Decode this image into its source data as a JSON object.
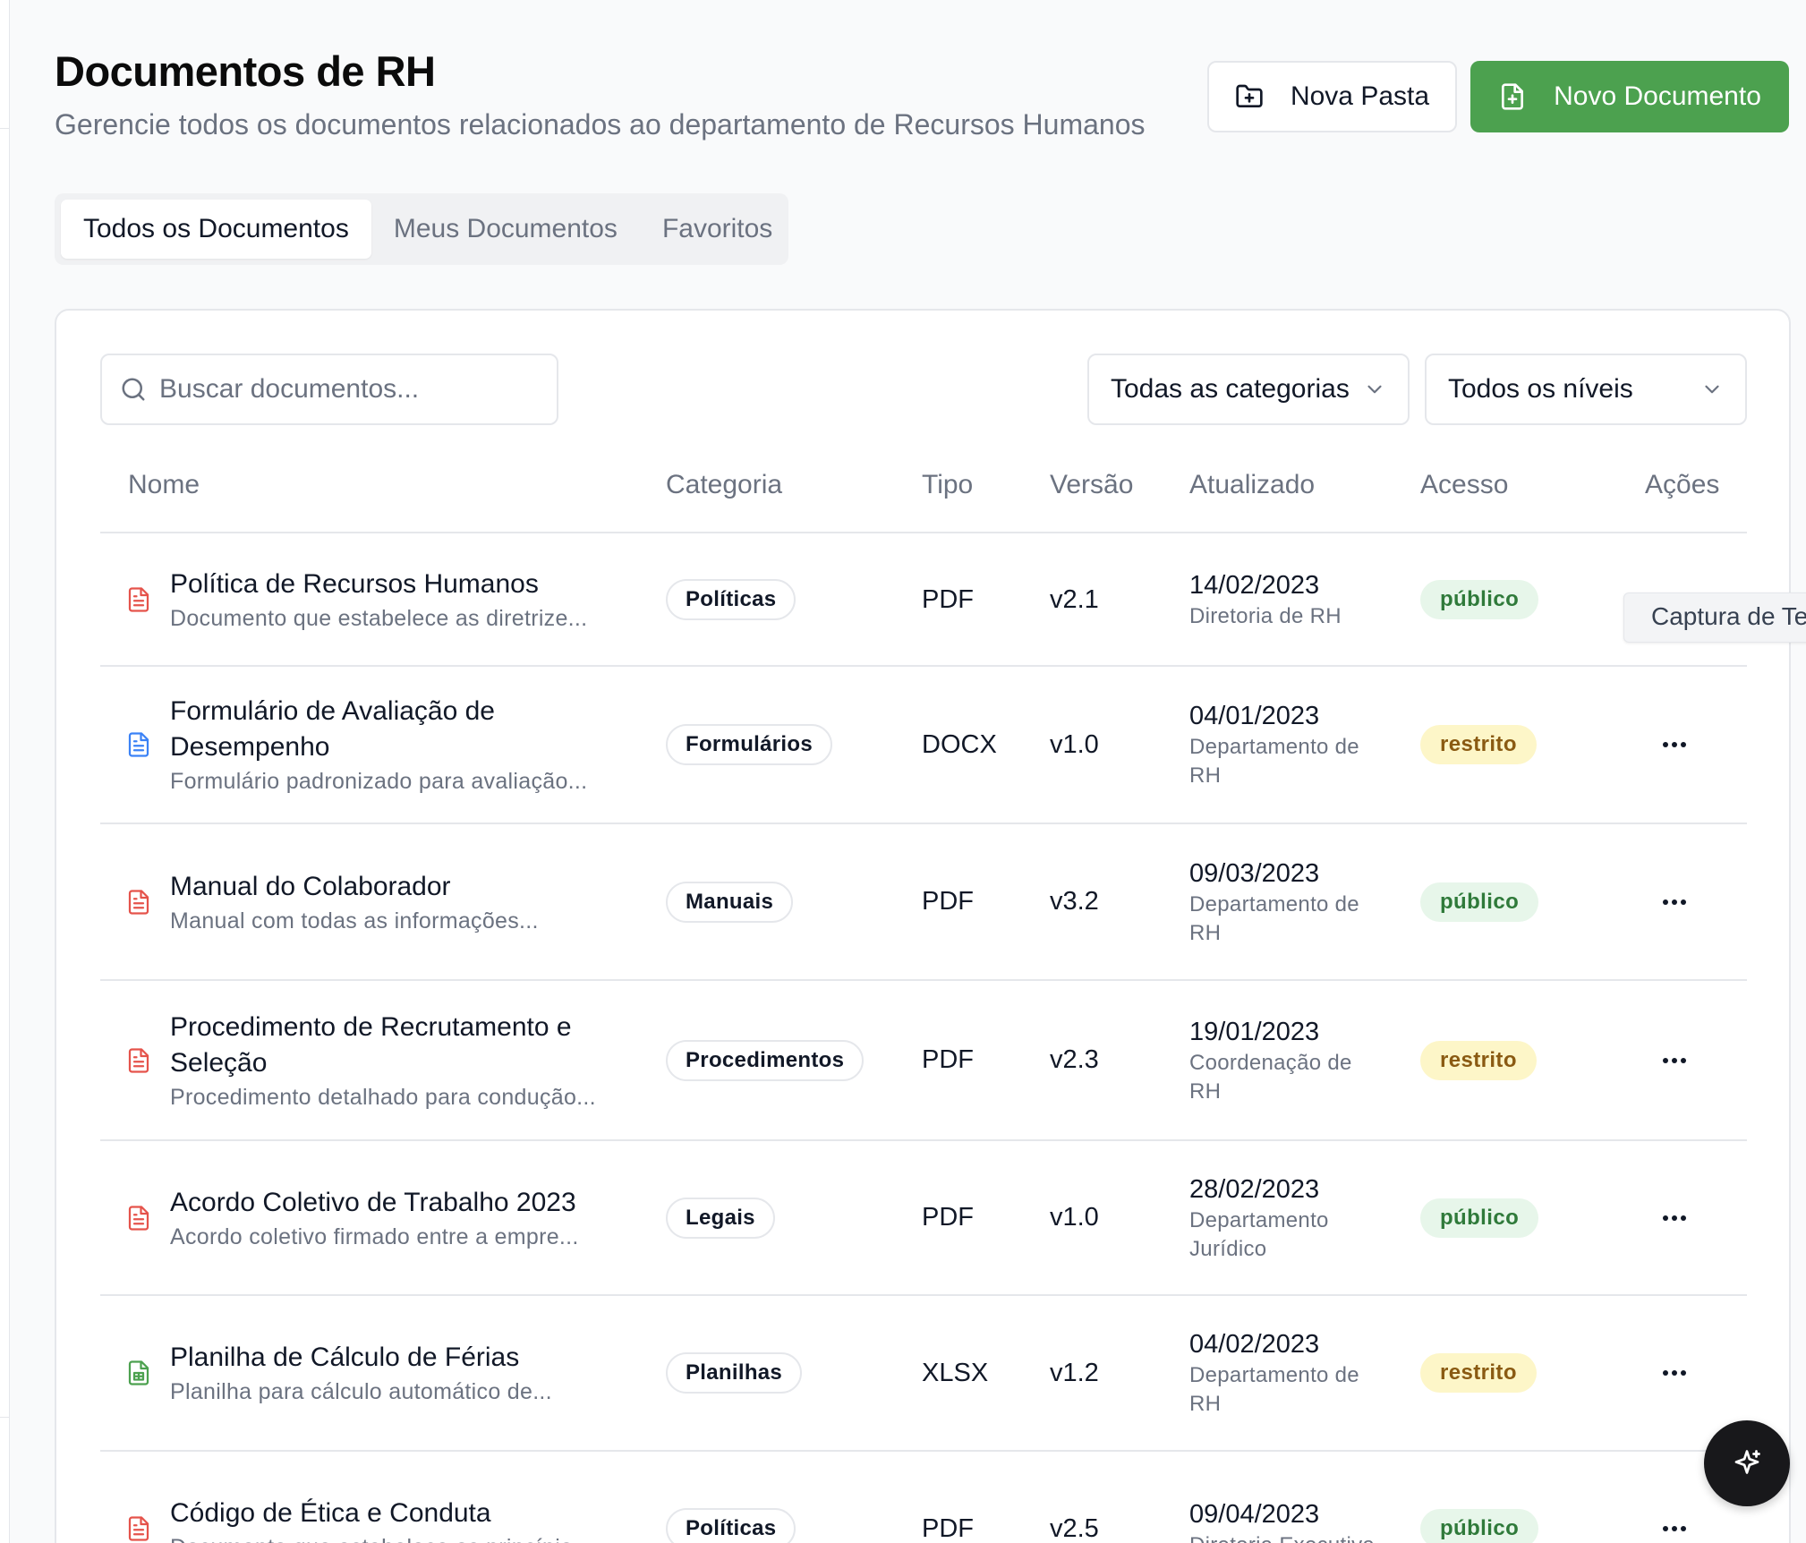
{
  "header": {
    "title": "Documentos de RH",
    "subtitle": "Gerencie todos os documentos relacionados ao departamento de Recursos Humanos"
  },
  "actions": {
    "new_folder_label": "Nova Pasta",
    "new_document_label": "Novo Documento"
  },
  "tabs": [
    {
      "label": "Todos os Documentos",
      "active": true
    },
    {
      "label": "Meus Documentos",
      "active": false
    },
    {
      "label": "Favoritos",
      "active": false
    }
  ],
  "filters": {
    "search_placeholder": "Buscar documentos...",
    "category_selected": "Todas as categorias",
    "level_selected": "Todos os níveis"
  },
  "table": {
    "columns": [
      "Nome",
      "Categoria",
      "Tipo",
      "Versão",
      "Atualizado",
      "Acesso",
      "Ações"
    ],
    "rows": [
      {
        "title": "Política de Recursos Humanos",
        "desc": "Documento que estabelece as diretrize...",
        "category": "Políticas",
        "type": "PDF",
        "version": "v2.1",
        "date": "14/02/2023",
        "dept": "Diretoria de RH",
        "access": "público",
        "icon": "file-text-icon",
        "icon_color": "#e5534b"
      },
      {
        "title": "Formulário de Avaliação de Desempenho",
        "desc": "Formulário padronizado para avaliação...",
        "category": "Formulários",
        "type": "DOCX",
        "version": "v1.0",
        "date": "04/01/2023",
        "dept": "Departamento de RH",
        "access": "restrito",
        "icon": "file-text-icon",
        "icon_color": "#3b82f6"
      },
      {
        "title": "Manual do Colaborador",
        "desc": "Manual com todas as informações...",
        "category": "Manuais",
        "type": "PDF",
        "version": "v3.2",
        "date": "09/03/2023",
        "dept": "Departamento de RH",
        "access": "público",
        "icon": "file-text-icon",
        "icon_color": "#e5534b"
      },
      {
        "title": "Procedimento de Recrutamento e Seleção",
        "desc": "Procedimento detalhado para condução...",
        "category": "Procedimentos",
        "type": "PDF",
        "version": "v2.3",
        "date": "19/01/2023",
        "dept": "Coordenação de RH",
        "access": "restrito",
        "icon": "file-text-icon",
        "icon_color": "#e5534b"
      },
      {
        "title": "Acordo Coletivo de Trabalho 2023",
        "desc": "Acordo coletivo firmado entre a empre...",
        "category": "Legais",
        "type": "PDF",
        "version": "v1.0",
        "date": "28/02/2023",
        "dept": "Departamento Jurídico",
        "access": "público",
        "icon": "file-text-icon",
        "icon_color": "#e5534b"
      },
      {
        "title": "Planilha de Cálculo de Férias",
        "desc": "Planilha para cálculo automático de...",
        "category": "Planilhas",
        "type": "XLSX",
        "version": "v1.2",
        "date": "04/02/2023",
        "dept": "Departamento de RH",
        "access": "restrito",
        "icon": "file-spreadsheet-icon",
        "icon_color": "#4ca14f"
      },
      {
        "title": "Código de Ética e Conduta",
        "desc": "Documento que estabelece os princípio...",
        "category": "Políticas",
        "type": "PDF",
        "version": "v2.5",
        "date": "09/04/2023",
        "dept": "Diretoria Executiva",
        "access": "público",
        "icon": "file-text-icon",
        "icon_color": "#e5534b"
      }
    ]
  },
  "tooltip": {
    "text": "Captura de Te"
  },
  "colors": {
    "primary": "#4ca14f",
    "public_bg": "#e7f6ea",
    "public_text": "#2f7a3a",
    "restricted_bg": "#fdf6c8",
    "restricted_text": "#8a5a12",
    "fab": "#18181b"
  },
  "fab": {
    "icon": "sparkles-icon"
  }
}
